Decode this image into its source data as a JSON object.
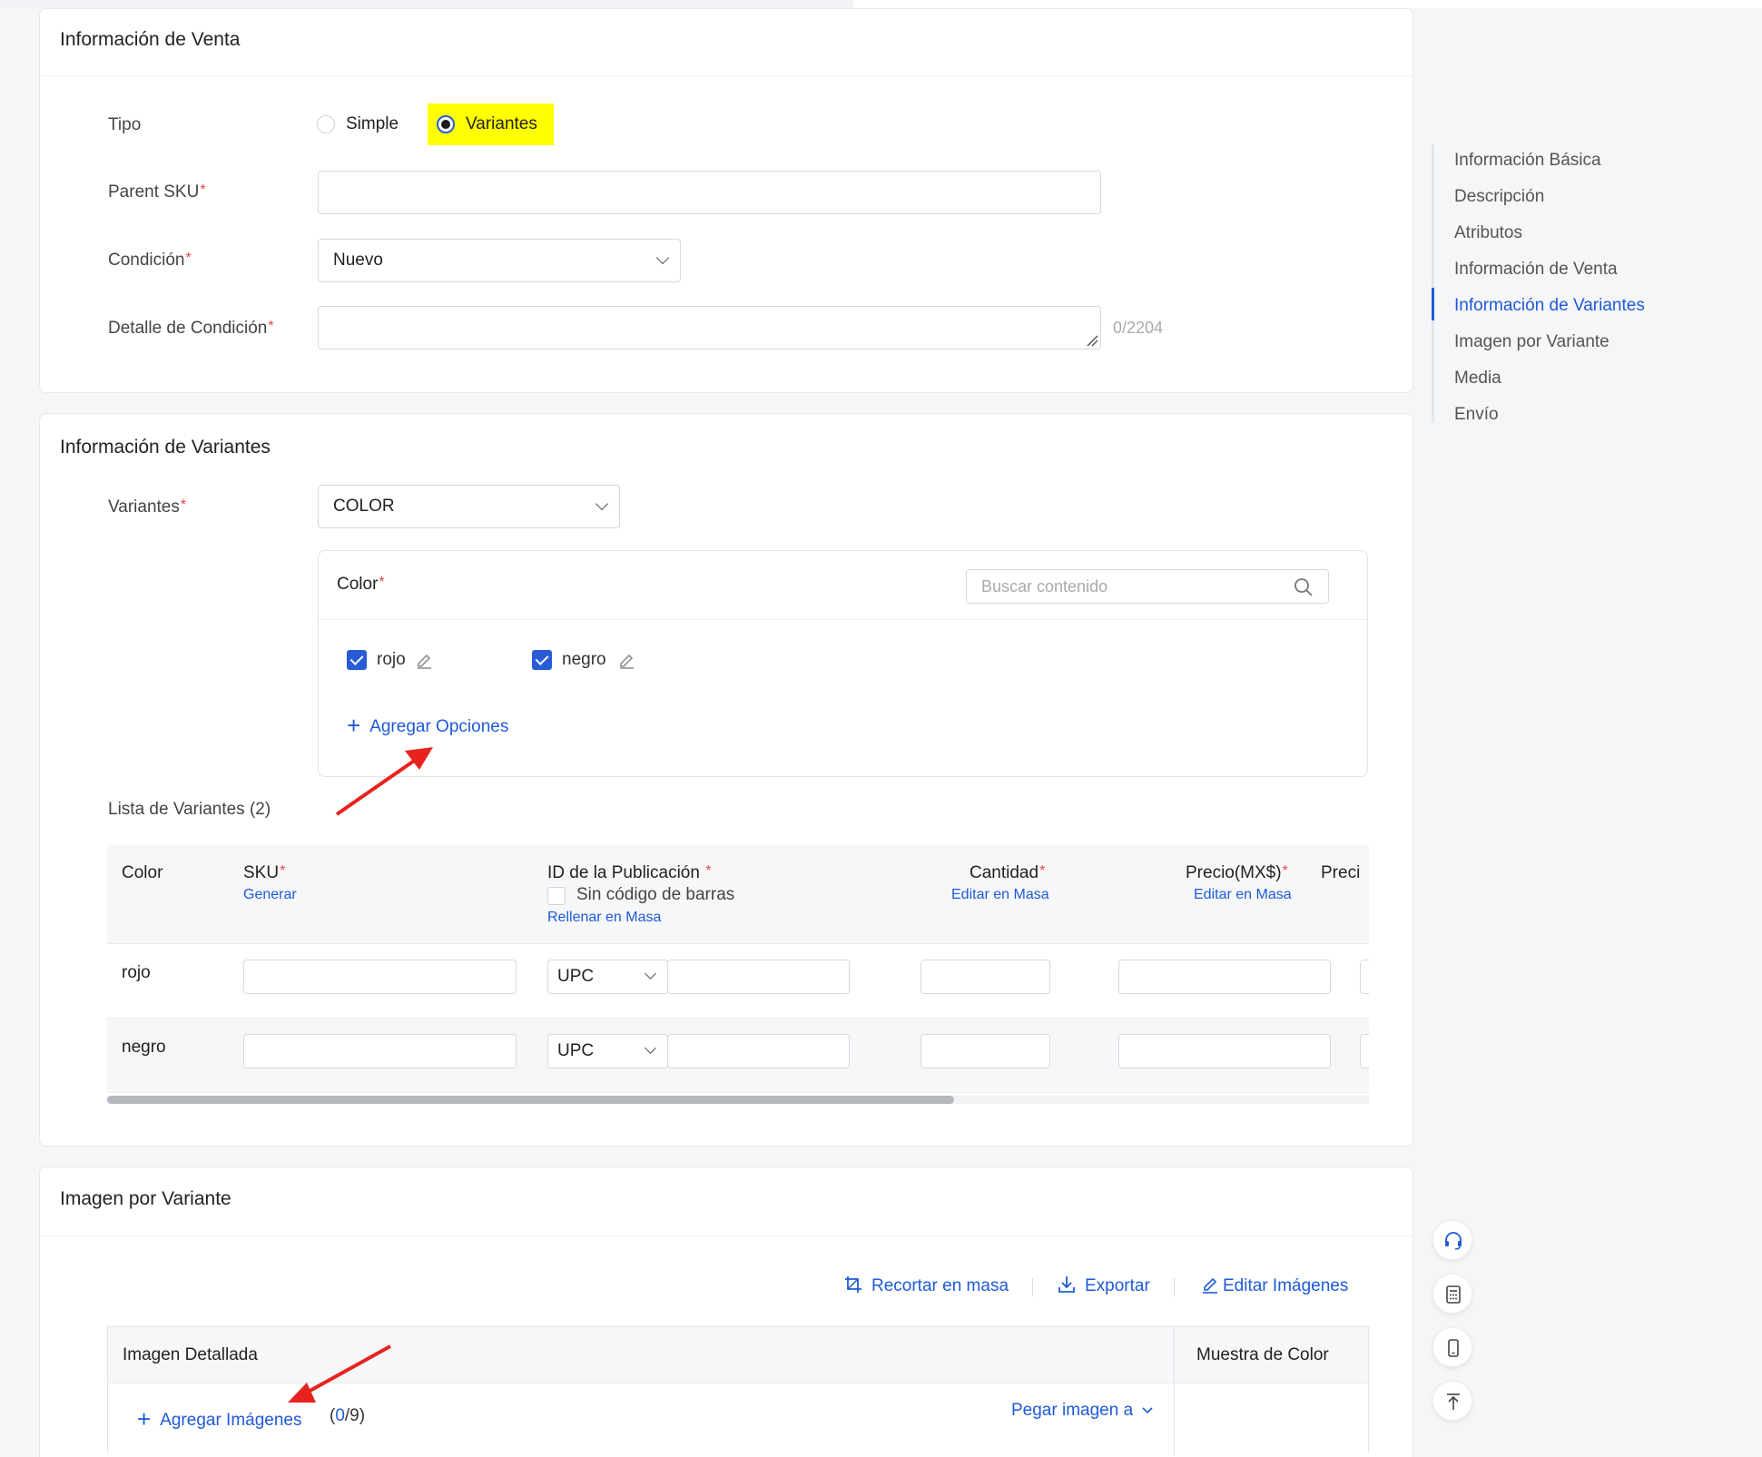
{
  "sale_info": {
    "title": "Información de Venta",
    "tipo_label": "Tipo",
    "tipo_options": [
      "Simple",
      "Variantes"
    ],
    "tipo_selected": "Variantes",
    "parent_sku_label": "Parent SKU",
    "condicion_label": "Condición",
    "condicion_value": "Nuevo",
    "detalle_label": "Detalle de Condición",
    "detalle_counter": "0/2204",
    "required_mark": "*"
  },
  "variant_info": {
    "title": "Información de Variantes",
    "variantes_label": "Variantes",
    "variantes_value": "COLOR",
    "color_label": "Color",
    "search_placeholder": "Buscar contenido",
    "options": [
      {
        "label": "rojo",
        "checked": true
      },
      {
        "label": "negro",
        "checked": true
      }
    ],
    "add_options": "Agregar Opciones",
    "list_title": "Lista de Variantes (2)",
    "table": {
      "headers": {
        "color": "Color",
        "sku": "SKU",
        "sku_link": "Generar",
        "pub_id": "ID de la Publicación",
        "no_barcode": "Sin código de barras",
        "fill_mass": "Rellenar en Masa",
        "cantidad": "Cantidad",
        "cantidad_link": "Editar en Masa",
        "precio": "Precio(MX$)",
        "precio_link": "Editar en Masa",
        "precio2": "Preci"
      },
      "rows": [
        {
          "color": "rojo",
          "code_type": "UPC"
        },
        {
          "color": "negro",
          "code_type": "UPC"
        }
      ]
    }
  },
  "image_info": {
    "title": "Imagen por Variante",
    "toolbar": {
      "crop": "Recortar en masa",
      "export": "Exportar",
      "edit": "Editar Imágenes"
    },
    "col_detail": "Imagen Detallada",
    "col_swatch": "Muestra de Color",
    "add_images": "Agregar Imágenes",
    "count_open": "(",
    "count_value": "0",
    "count_rest": "/9)",
    "paste": "Pegar imagen a"
  },
  "side_nav": {
    "items": [
      "Información Básica",
      "Descripción",
      "Atributos",
      "Información de Venta",
      "Información de Variantes",
      "Imagen por Variante",
      "Media",
      "Envío"
    ],
    "active": "Información de Variantes"
  },
  "float_buttons": [
    "headset-icon",
    "calculator-icon",
    "mobile-icon",
    "back-to-top-icon"
  ],
  "colors": {
    "accent": "#1f5ad6",
    "required": "#e54545",
    "highlight": "#ffff00",
    "arrow": "#e8231f"
  }
}
